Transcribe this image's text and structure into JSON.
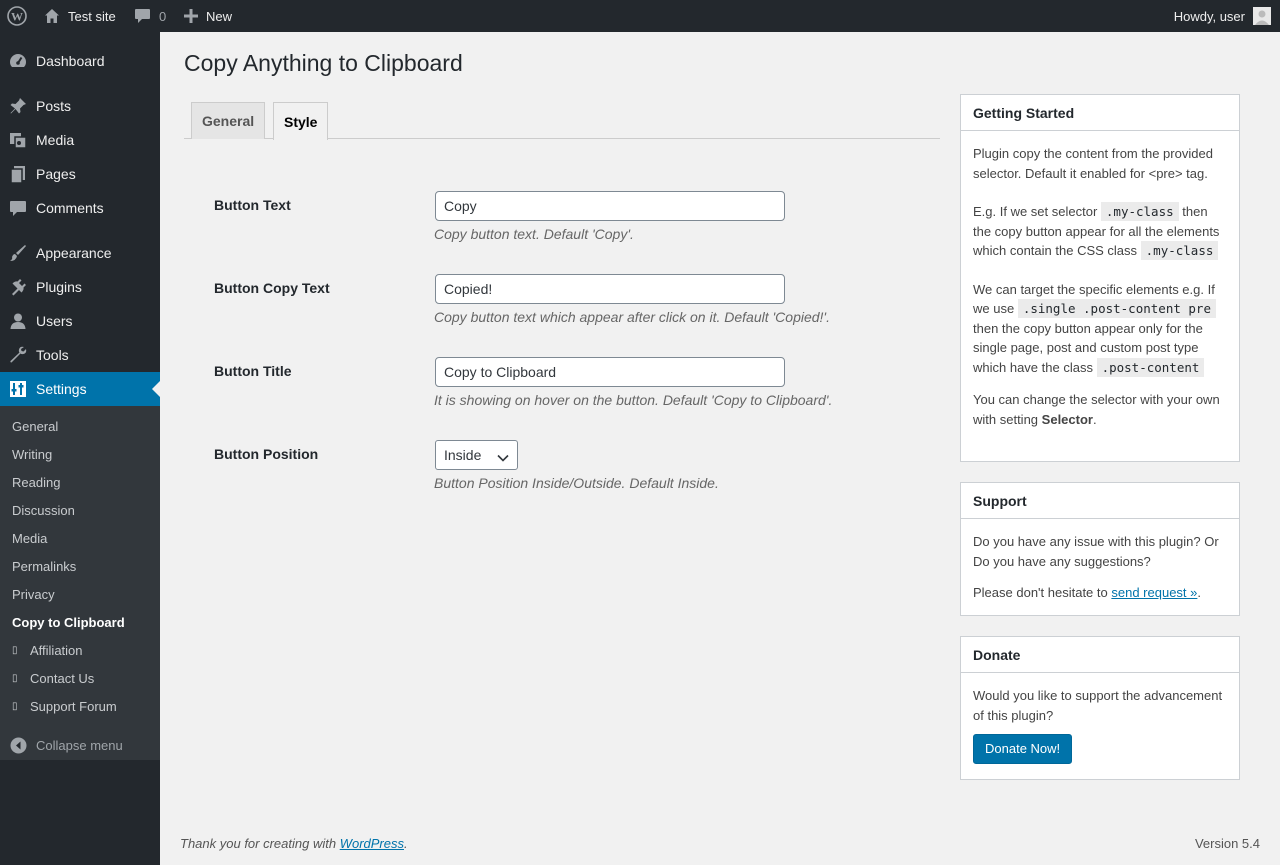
{
  "adminbar": {
    "site_name": "Test site",
    "comments_count": "0",
    "new_label": "New",
    "howdy": "Howdy, user"
  },
  "menu": {
    "items": [
      {
        "label": "Dashboard",
        "icon": "dashboard-icon"
      },
      {
        "label": "Posts",
        "icon": "pin-icon"
      },
      {
        "label": "Media",
        "icon": "media-icon"
      },
      {
        "label": "Pages",
        "icon": "pages-icon"
      },
      {
        "label": "Comments",
        "icon": "comment-icon"
      },
      {
        "label": "Appearance",
        "icon": "brush-icon"
      },
      {
        "label": "Plugins",
        "icon": "plug-icon"
      },
      {
        "label": "Users",
        "icon": "user-icon"
      },
      {
        "label": "Tools",
        "icon": "wrench-icon"
      },
      {
        "label": "Settings",
        "icon": "settings-icon"
      }
    ],
    "submenu": [
      "General",
      "Writing",
      "Reading",
      "Discussion",
      "Media",
      "Permalinks",
      "Privacy",
      "Copy to Clipboard",
      "Affiliation",
      "Contact Us",
      "Support Forum"
    ],
    "collapse": "Collapse menu"
  },
  "page": {
    "title": "Copy Anything to Clipboard",
    "tabs": [
      "General",
      "Style"
    ],
    "active_tab": "Style",
    "fields": [
      {
        "label": "Button Text",
        "value": "Copy",
        "desc": "Copy button text. Default 'Copy'."
      },
      {
        "label": "Button Copy Text",
        "value": "Copied!",
        "desc": "Copy button text which appear after click on it. Default 'Copied!'."
      },
      {
        "label": "Button Title",
        "value": "Copy to Clipboard",
        "desc": "It is showing on hover on the button. Default 'Copy to Clipboard'."
      },
      {
        "label": "Button Position",
        "value": "Inside",
        "desc": "Button Position Inside/Outside. Default Inside."
      }
    ]
  },
  "boxes": {
    "getting_started": {
      "title": "Getting Started",
      "p1": "Plugin copy the content from the provided selector. Default it enabled for <pre> tag.",
      "p2_a": "E.g. If we set selector",
      "p2_code1": ".my-class",
      "p2_b": "then the copy button appear for all the elements which contain the CSS class",
      "p2_code2": ".my-class",
      "p3_a": "We can target the specific elements e.g. If we use",
      "p3_code1": ".single .post-content pre",
      "p3_b": "then the copy button appear only for the single page, post and custom post type which have the class",
      "p3_code2": ".post-content",
      "p4_a": "You can change the selector with your own with setting",
      "p4_bold": "Selector",
      "p4_end": "."
    },
    "support": {
      "title": "Support",
      "p1": "Do you have any issue with this plugin? Or Do you have any suggestions?",
      "p2_a": "Please don't hesitate to",
      "p2_link": "send request »",
      "p2_end": "."
    },
    "donate": {
      "title": "Donate",
      "p1": "Would you like to support the advancement of this plugin?",
      "button": "Donate Now!"
    }
  },
  "footer": {
    "thanks_a": "Thank you for creating with",
    "thanks_link": "WordPress",
    "thanks_end": ".",
    "version": "Version 5.4"
  },
  "colors": {
    "accent": "#0073aa",
    "sidebar": "#23282d",
    "submenu": "#32373c"
  }
}
